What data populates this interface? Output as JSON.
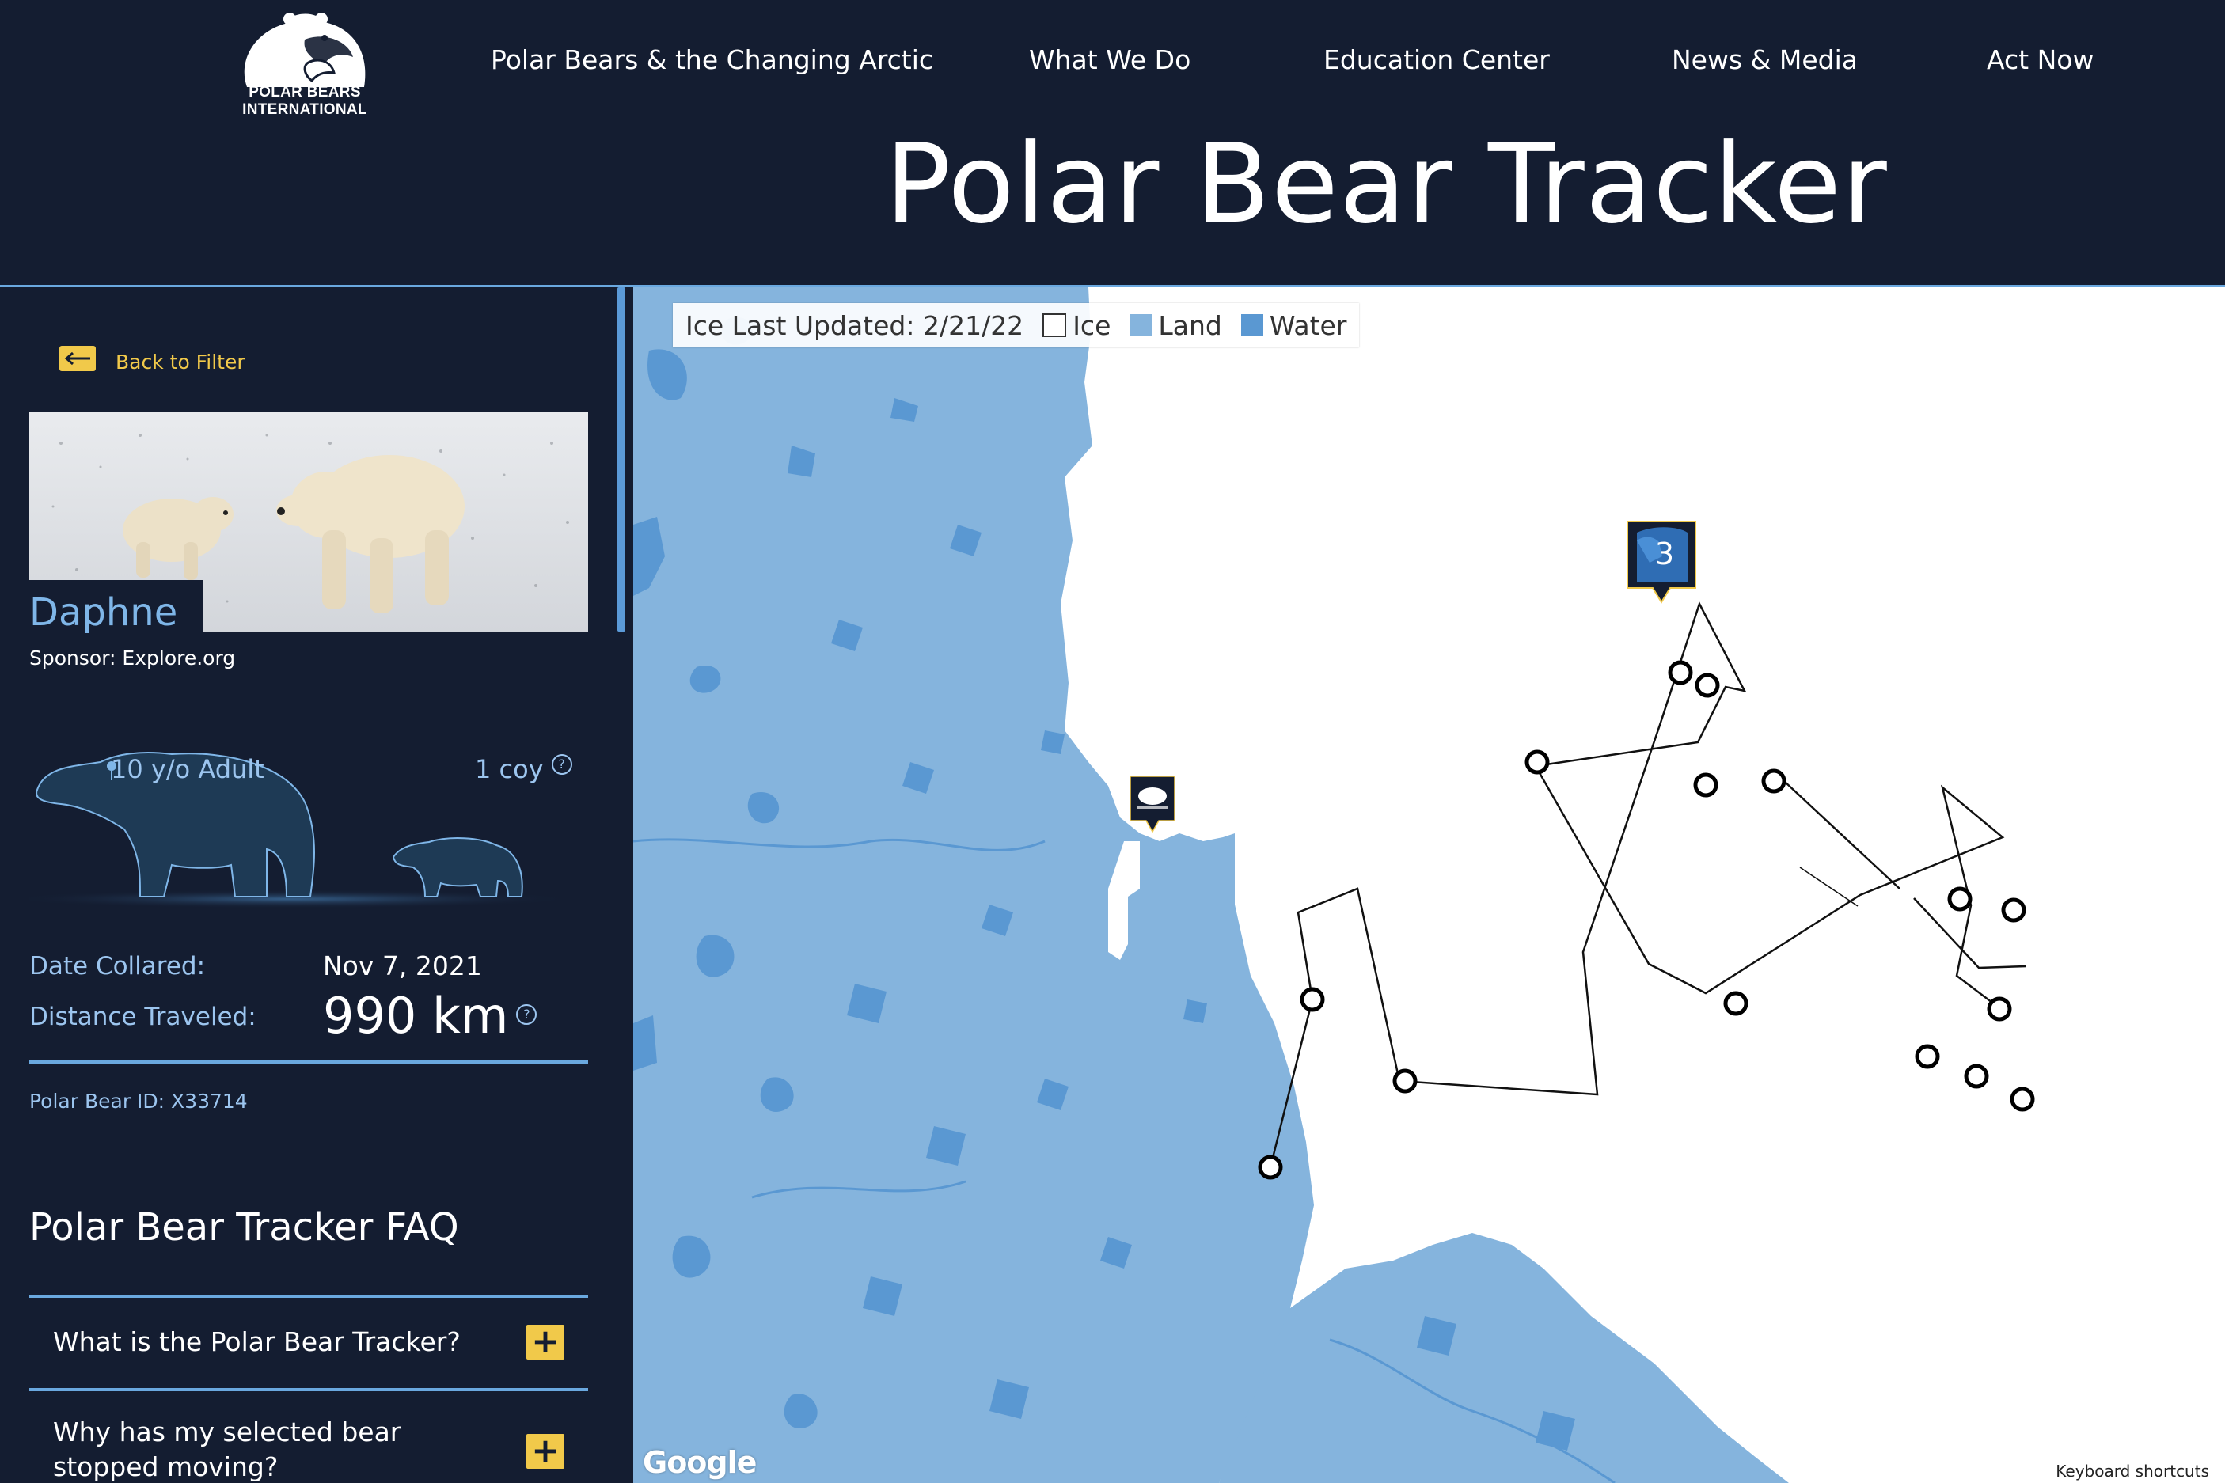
{
  "brand": {
    "logo_text_line1": "POLAR BEARS",
    "logo_text_line2": "INTERNATIONAL"
  },
  "nav": {
    "items": [
      {
        "label": "Polar Bears & the Changing Arctic"
      },
      {
        "label": "What We Do"
      },
      {
        "label": "Education Center"
      },
      {
        "label": "News & Media"
      },
      {
        "label": "Act Now"
      }
    ]
  },
  "page": {
    "title": "Polar Bear Tracker"
  },
  "sidebar": {
    "back_label": "Back to Filter",
    "bear": {
      "name": "Daphne",
      "sponsor": "Sponsor: Explore.org",
      "age": "10 y/o Adult",
      "cubs": "1 coy",
      "date_collared_label": "Date Collared:",
      "date_collared": "Nov 7, 2021",
      "distance_label": "Distance Traveled:",
      "distance": "990 km",
      "id": "Polar Bear ID: X33714"
    },
    "faq": {
      "title": "Polar Bear Tracker FAQ",
      "items": [
        {
          "question": "What is the Polar Bear Tracker?"
        },
        {
          "question": "Why has my selected bear stopped moving?"
        }
      ]
    },
    "help_icon": "question-circle-icon",
    "plus_icon": "plus-icon"
  },
  "map": {
    "legend": {
      "updated": "Ice Last Updated: 2/21/22",
      "ice": "Ice",
      "land": "Land",
      "water": "Water"
    },
    "colors": {
      "land": "#85b4dd",
      "water": "#5a98d2",
      "ice": "#ffffff",
      "accent": "#f1c94a",
      "navy": "#141d31"
    },
    "marker_count": "3",
    "attribution": "Google",
    "keyboard_shortcuts": "Keyboard shortcuts",
    "track_points": "bear-track-waypoints"
  }
}
